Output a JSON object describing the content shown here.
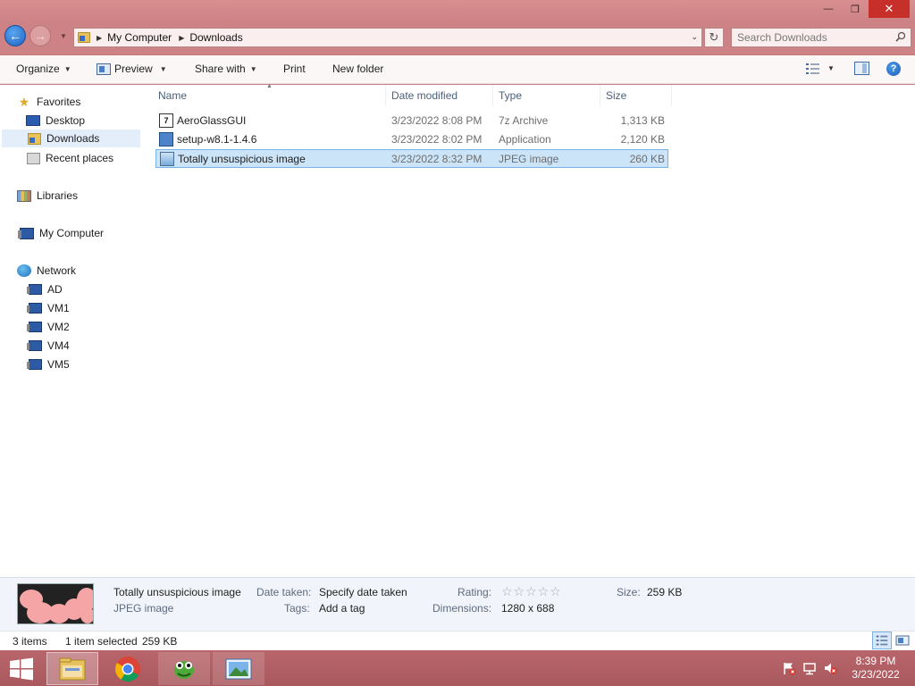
{
  "titlebar": {
    "minimize": "—",
    "restore": "❐",
    "close": "✕"
  },
  "navigation": {
    "back": "←",
    "forward": "→",
    "recent": "▼",
    "breadcrumbs": [
      "My Computer",
      "Downloads"
    ],
    "address_dropdown": "⌄",
    "refresh": "↻",
    "search_placeholder": "Search Downloads"
  },
  "toolbar": {
    "organize": "Organize",
    "preview": "Preview",
    "share_with": "Share with",
    "print": "Print",
    "new_folder": "New folder",
    "help": "?"
  },
  "nav_pane": {
    "favorites": "Favorites",
    "desktop": "Desktop",
    "downloads": "Downloads",
    "recent_places": "Recent places",
    "libraries": "Libraries",
    "my_computer": "My Computer",
    "network": "Network",
    "network_hosts": [
      "AD",
      "VM1",
      "VM2",
      "VM4",
      "VM5"
    ]
  },
  "file_list": {
    "columns": [
      "Name",
      "Date modified",
      "Type",
      "Size"
    ],
    "sort_indicator": "▲",
    "files": [
      {
        "name": "AeroGlassGUI",
        "date": "3/23/2022 8:08 PM",
        "type": "7z Archive",
        "size": "1,313 KB",
        "icon": "archive-icon"
      },
      {
        "name": "setup-w8.1-1.4.6",
        "date": "3/23/2022 8:02 PM",
        "type": "Application",
        "size": "2,120 KB",
        "icon": "setup-icon"
      },
      {
        "name": "Totally unsuspicious image",
        "date": "3/23/2022 8:32 PM",
        "type": "JPEG image",
        "size": "260 KB",
        "icon": "image-icon"
      }
    ],
    "selected_index": 2
  },
  "details_pane": {
    "filename": "Totally unsuspicious image",
    "filetype": "JPEG image",
    "date_taken_label": "Date taken:",
    "date_taken_value": "Specify date taken",
    "tags_label": "Tags:",
    "tags_value": "Add a tag",
    "rating_label": "Rating:",
    "rating_stars": "☆☆☆☆☆",
    "rating_value": 0,
    "dimensions_label": "Dimensions:",
    "dimensions_value": "1280 x 688",
    "size_label": "Size:",
    "size_value": "259 KB"
  },
  "status_bar": {
    "items": "3 items",
    "selection": "1 item selected",
    "selection_size": "259 KB"
  },
  "taskbar": {
    "apps": [
      "file-explorer-icon",
      "chrome-icon",
      "gecko-app-icon",
      "photo-viewer-icon"
    ],
    "time": "8:39 PM",
    "date": "3/23/2022"
  },
  "colors": {
    "accent": "#cd8386",
    "selection": "#cce4f7",
    "selection_border": "#7ab1e6",
    "close_button": "#c7302a"
  }
}
